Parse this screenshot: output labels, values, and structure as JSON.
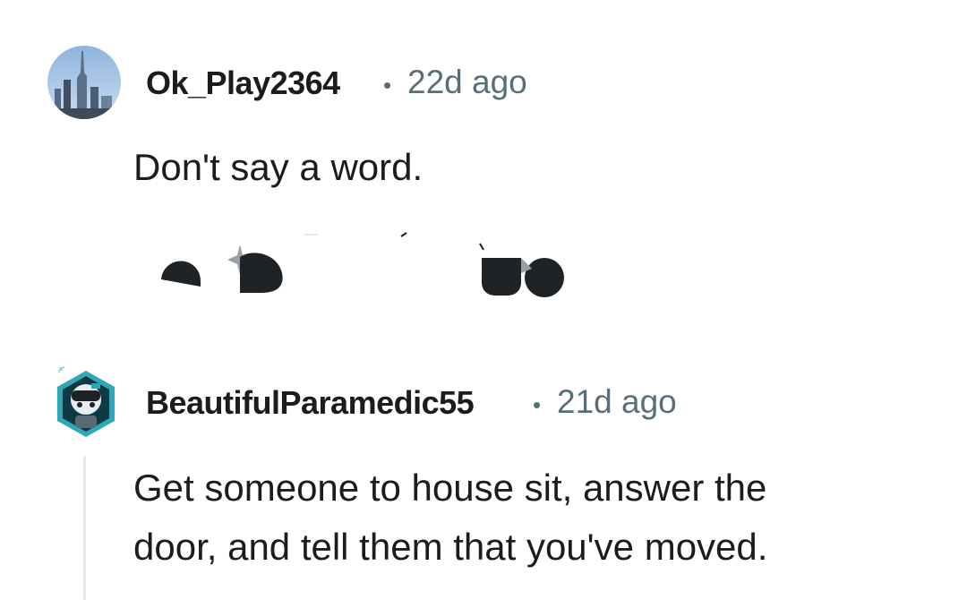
{
  "comments": [
    {
      "username": "Ok_Play2364",
      "separator": "•",
      "timestamp": "22d ago",
      "body": "Don't say a word."
    },
    {
      "username": "BeautifulParamedic55",
      "separator": "•",
      "timestamp": "21d ago",
      "body_line1": "Get someone to house sit, answer the",
      "body_line2": "door, and tell them that you've moved."
    }
  ],
  "icons": {
    "avatar1": "avatar-city-skyline",
    "avatar2": "avatar-snoo-hexagon",
    "embedded": "partially-rendered-emoji-fragments"
  },
  "colors": {
    "text": "#1c1c1c",
    "meta": "#576f76",
    "thread_line": "#e5e8ea"
  }
}
